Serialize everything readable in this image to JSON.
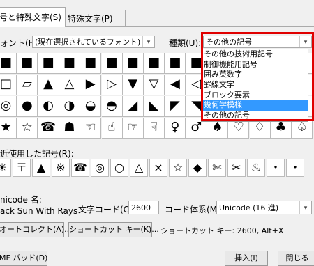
{
  "tabs": [
    "号と特殊文字(S)",
    "特殊文字(P)"
  ],
  "font": {
    "label": "ォント(F):",
    "value": "(現在選択されているフォント)"
  },
  "subset": {
    "label": "種類(U):",
    "value": "その他の記号"
  },
  "dropdown_items": [
    "その他の技術用記号",
    "制御機能用記号",
    "囲み英数字",
    "罫線文字",
    "ブロック要素",
    "幾何学模様",
    "その他の記号"
  ],
  "dropdown_selected_index": 5,
  "grid_rows": [
    [
      "■",
      "■",
      "■",
      "■",
      "■",
      "■",
      "■",
      "■",
      "■",
      "■",
      "■",
      "■",
      "■",
      "■",
      "■"
    ],
    [
      "□",
      "▱",
      "▲",
      "△",
      "▶",
      "▷",
      "▼",
      "▽",
      "◀",
      "◁",
      "◆",
      "◇",
      "◈",
      "○",
      "◉"
    ],
    [
      "◎",
      "●",
      "◐",
      "◑",
      "◒",
      "◓",
      "◢",
      "◣",
      "◤",
      "◥",
      "◦",
      "◯",
      "☀",
      "☁",
      "☂"
    ],
    [
      "★",
      "☆",
      "☎",
      "☗",
      "☜",
      "☝",
      "☞",
      "☟",
      "♀",
      "♂",
      "♠",
      "♡",
      "♢",
      "♣",
      "♤"
    ]
  ],
  "recent": {
    "label": "近使用した記号(R):",
    "symbols": [
      "☀",
      "〒",
      "▲",
      "※",
      "☎",
      "◎",
      "○",
      "△",
      "×",
      "☆",
      "◆",
      "✄",
      "✂",
      "♨",
      "・",
      "・"
    ]
  },
  "unicode_name": {
    "label": "nicode 名:",
    "value": "ack Sun With Rays"
  },
  "charcode": {
    "label": "文字コード(C):",
    "value": "2600"
  },
  "from": {
    "label": "コード体系(M):",
    "value": "Unicode (16 進)"
  },
  "autocorrect_button": "オートコレクト(A)...",
  "shortcut_button": "ショートカット キー(K)...",
  "shortcut_text": "ショートカット キー: 2600, Alt+X",
  "bottom_left_button": "MF パッド(D)",
  "insert_button": "挿入(I)",
  "close_button": "閉じる"
}
